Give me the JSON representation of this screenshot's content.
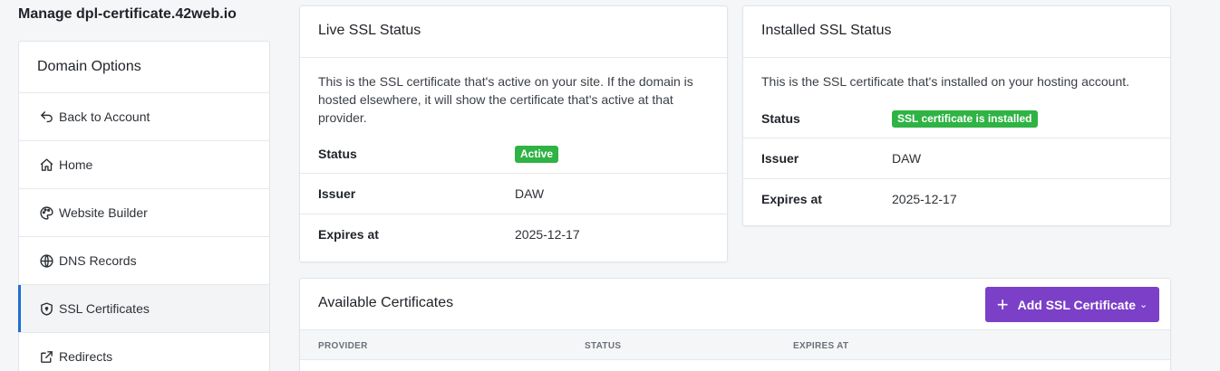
{
  "page_title": "Manage dpl-certificate.42web.io",
  "sidebar": {
    "heading": "Domain Options",
    "items": [
      {
        "label": "Back to Account",
        "icon": "back-arrow-icon"
      },
      {
        "label": "Home",
        "icon": "home-icon"
      },
      {
        "label": "Website Builder",
        "icon": "palette-icon"
      },
      {
        "label": "DNS Records",
        "icon": "globe-icon"
      },
      {
        "label": "SSL Certificates",
        "icon": "shield-icon",
        "active": true
      },
      {
        "label": "Redirects",
        "icon": "external-link-icon"
      }
    ]
  },
  "live_ssl": {
    "title": "Live SSL Status",
    "description": "This is the SSL certificate that's active on your site. If the domain is hosted elsewhere, it will show the certificate that's active at that provider.",
    "status_label": "Status",
    "status_value": "Active",
    "issuer_label": "Issuer",
    "issuer_value": "DAW",
    "expires_label": "Expires at",
    "expires_value": "2025-12-17"
  },
  "installed_ssl": {
    "title": "Installed SSL Status",
    "description": "This is the SSL certificate that's installed on your hosting account.",
    "status_label": "Status",
    "status_value": "SSL certificate is installed",
    "issuer_label": "Issuer",
    "issuer_value": "DAW",
    "expires_label": "Expires at",
    "expires_value": "2025-12-17"
  },
  "available": {
    "title": "Available Certificates",
    "add_button_label": "Add SSL Certificate",
    "columns": [
      "PROVIDER",
      "STATUS",
      "EXPIRES AT"
    ]
  },
  "colors": {
    "accent_purple": "#7b3fc8",
    "success_green": "#2fb344",
    "active_indicator": "#1f6fd0"
  }
}
